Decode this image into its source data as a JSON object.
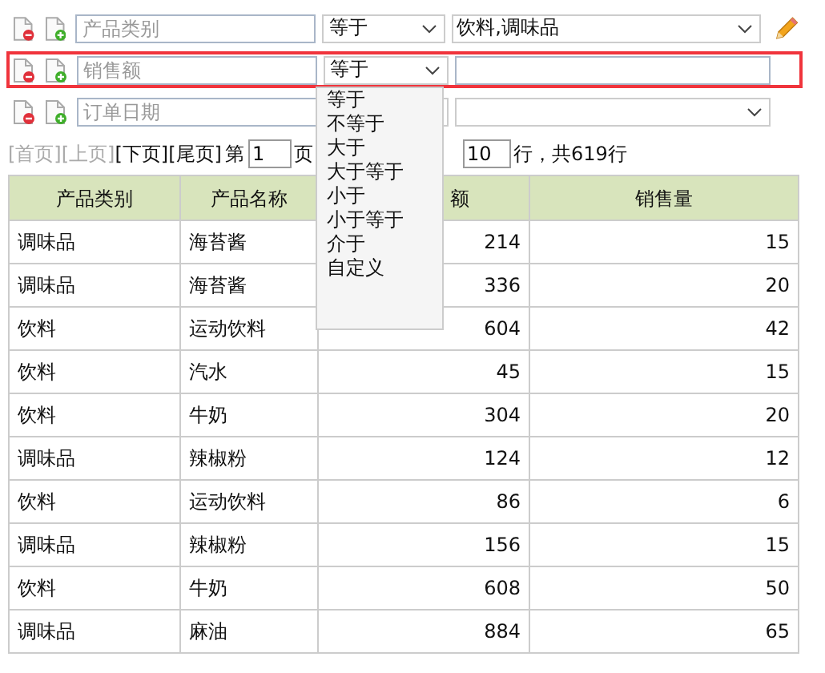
{
  "filters": [
    {
      "field_placeholder": "产品类别",
      "operator": "等于",
      "kind": "select",
      "value": "饮料,调味品",
      "edit_icon": true,
      "highlighted": false
    },
    {
      "field_placeholder": "销售额",
      "operator": "等于",
      "kind": "text",
      "edit_icon": false,
      "highlighted": true,
      "operator_menu": [
        "等于",
        "不等于",
        "大于",
        "大于等于",
        "小于",
        "小于等于",
        "介于",
        "自定义"
      ]
    },
    {
      "field_placeholder": "订单日期",
      "kind": "select",
      "edit_icon": false,
      "highlighted": false
    }
  ],
  "pager": {
    "links": [
      {
        "label": "[首页]",
        "disabled": true
      },
      {
        "label": "[上页]",
        "disabled": true
      },
      {
        "label": "[下页]",
        "disabled": false
      },
      {
        "label": "[尾页]",
        "disabled": false
      }
    ],
    "page_prefix": "第",
    "page": "1",
    "page_suffix": "页",
    "page_size": "10",
    "total": "行，共619行"
  },
  "table": {
    "columns": [
      "产品类别",
      "产品名称",
      "额",
      "销售量"
    ],
    "rows": [
      [
        "调味品",
        "海苔酱",
        "214",
        "15"
      ],
      [
        "调味品",
        "海苔酱",
        "336",
        "20"
      ],
      [
        "饮料",
        "运动饮料",
        "604",
        "42"
      ],
      [
        "饮料",
        "汽水",
        "45",
        "15"
      ],
      [
        "饮料",
        "牛奶",
        "304",
        "20"
      ],
      [
        "调味品",
        "辣椒粉",
        "124",
        "12"
      ],
      [
        "饮料",
        "运动饮料",
        "86",
        "6"
      ],
      [
        "调味品",
        "辣椒粉",
        "156",
        "15"
      ],
      [
        "饮料",
        "牛奶",
        "608",
        "50"
      ],
      [
        "调味品",
        "麻油",
        "884",
        "65"
      ]
    ]
  }
}
